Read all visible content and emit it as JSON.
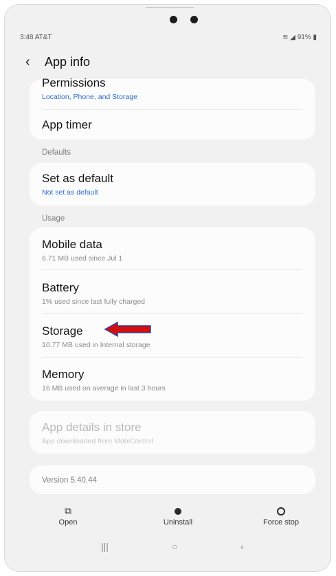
{
  "status": {
    "time_carrier": "3:48 AT&T",
    "icons": "91%"
  },
  "header": {
    "title": "App info"
  },
  "sections": {
    "defaults": "Defaults",
    "usage": "Usage"
  },
  "items": {
    "permissions": {
      "title": "Permissions",
      "subtitle": "Location, Phone, and Storage"
    },
    "app_timer": {
      "title": "App timer"
    },
    "set_default": {
      "title": "Set as default",
      "subtitle": "Not set as default"
    },
    "mobile_data": {
      "title": "Mobile data",
      "subtitle": "6.71 MB used since Jul 1"
    },
    "battery": {
      "title": "Battery",
      "subtitle": "1% used since last fully charged"
    },
    "storage": {
      "title": "Storage",
      "subtitle": "10.77 MB used in Internal storage"
    },
    "memory": {
      "title": "Memory",
      "subtitle": "16 MB used on average in last 3 hours"
    },
    "app_details": {
      "title": "App details in store",
      "subtitle": "App downloaded from MobiControl"
    }
  },
  "version": "Version 5.40.44",
  "actions": {
    "open": "Open",
    "uninstall": "Uninstall",
    "force_stop": "Force stop"
  },
  "colors": {
    "accent_blue": "#2c6bd1",
    "arrow_red": "#d20f0f",
    "arrow_outline": "#2f3f9f"
  }
}
